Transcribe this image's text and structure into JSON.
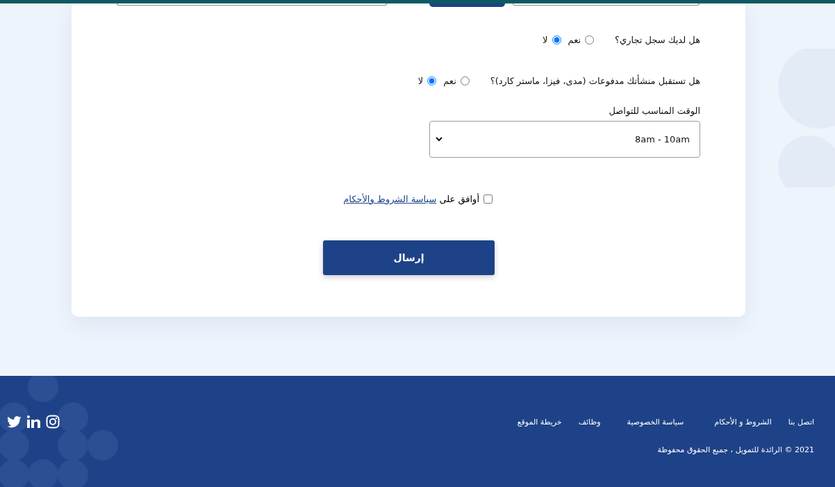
{
  "questions": [
    {
      "label": "هل لديك سجل تجاري؟",
      "options": [
        {
          "label": "نعم",
          "selected": false
        },
        {
          "label": "لا",
          "selected": true
        }
      ]
    },
    {
      "label": "هل تستقبل منشأتك مدفوعات (مدى، فيزا، ماستر كارد)؟",
      "options": [
        {
          "label": "نعم",
          "selected": false
        },
        {
          "label": "لا",
          "selected": true
        }
      ]
    }
  ],
  "contact_time": {
    "label": "الوقت المناسب للتواصل",
    "value": "8am - 10am"
  },
  "agree": {
    "checked": false,
    "text": "أوافق على",
    "link": "سياسة الشروط والأحكام"
  },
  "submit": "إرسال",
  "footer": {
    "links": [
      "اتصل بنا",
      "الشروط و الأحكام",
      "سياسة الخصوصية",
      "وظائف",
      "خريطة الموقع"
    ],
    "copyright": "2021 © الرائدة للتمويل ، جميع الحقوق محفوظة"
  }
}
